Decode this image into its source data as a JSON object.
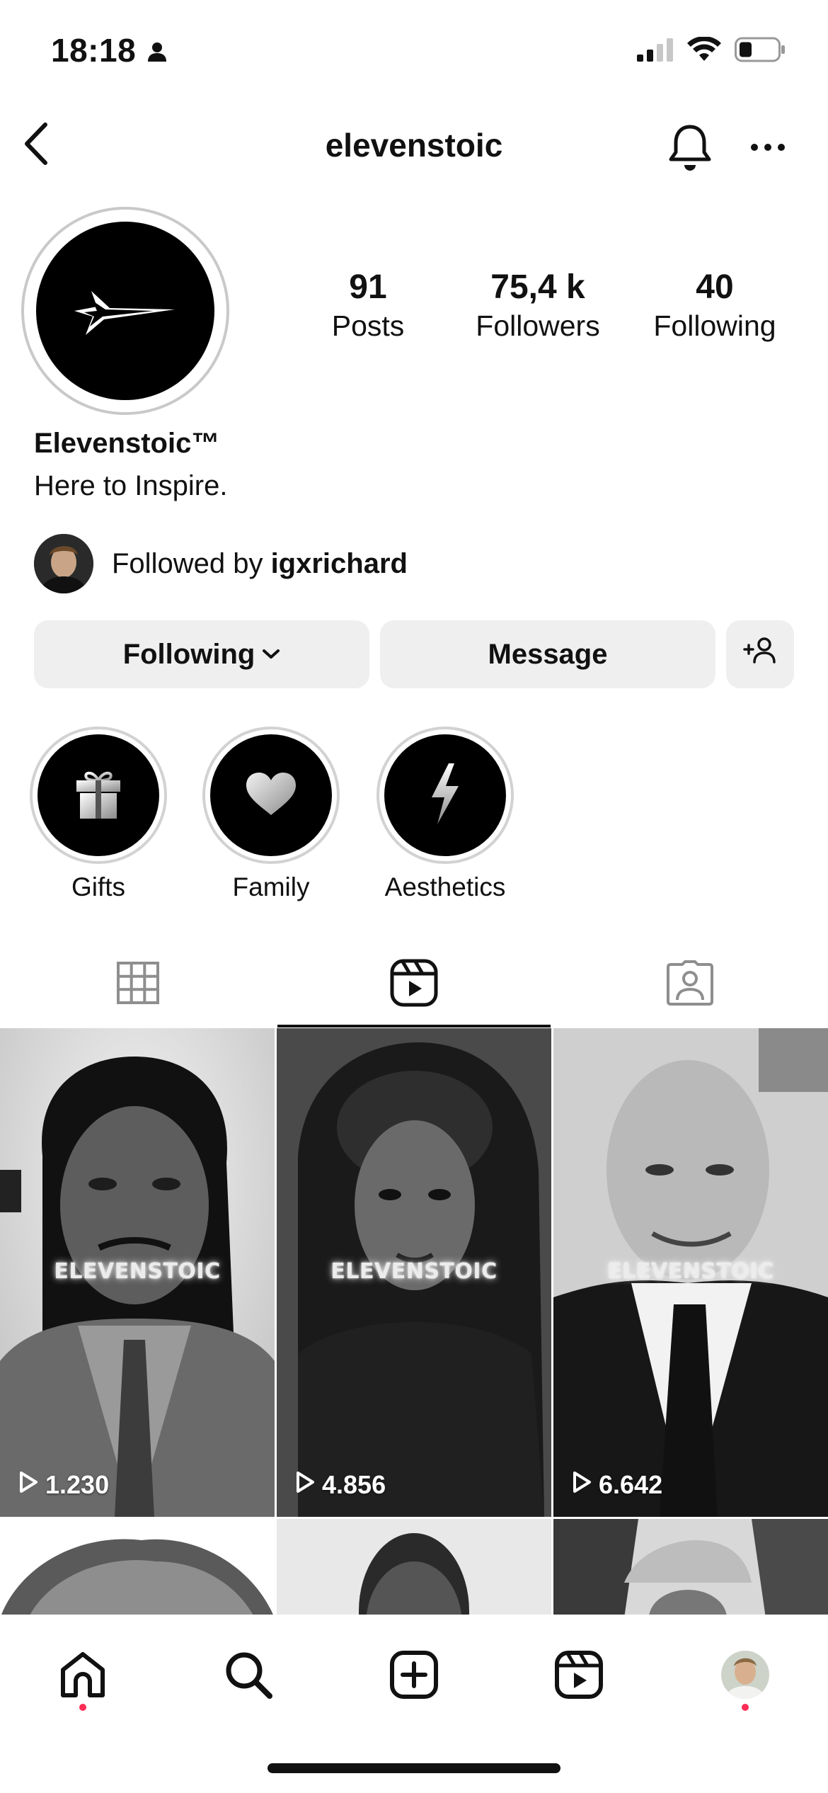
{
  "status_bar": {
    "time": "18:18"
  },
  "header": {
    "username": "elevenstoic"
  },
  "profile": {
    "stats": [
      {
        "count": "91",
        "label": "Posts"
      },
      {
        "count": "75,4 k",
        "label": "Followers"
      },
      {
        "count": "40",
        "label": "Following"
      }
    ],
    "display_name": "Elevenstoic™",
    "bio": "Here to Inspire.",
    "followed_by_prefix": "Followed by ",
    "followed_by_user": "igxrichard"
  },
  "actions": {
    "following_label": "Following",
    "message_label": "Message"
  },
  "highlights": [
    {
      "label": "Gifts",
      "icon": "gift-icon"
    },
    {
      "label": "Family",
      "icon": "heart-icon"
    },
    {
      "label": "Aesthetics",
      "icon": "lightning-icon"
    }
  ],
  "tabs": [
    {
      "name": "posts-grid",
      "icon": "grid-icon",
      "active": false
    },
    {
      "name": "reels",
      "icon": "reels-icon",
      "active": true
    },
    {
      "name": "tagged",
      "icon": "tagged-person-icon",
      "active": false
    }
  ],
  "reels": [
    {
      "caption": "ELEVENSTOIC",
      "views": "1.230"
    },
    {
      "caption": "ELEVENSTOIC",
      "views": "4.856"
    },
    {
      "caption": "ELEVENSTOIC",
      "views": "6.642"
    }
  ],
  "bottom_nav": [
    {
      "name": "home",
      "icon": "home-icon",
      "notification_dot": true
    },
    {
      "name": "search",
      "icon": "search-icon",
      "notification_dot": false
    },
    {
      "name": "create",
      "icon": "plus-square-icon",
      "notification_dot": false
    },
    {
      "name": "reels",
      "icon": "reels-icon",
      "notification_dot": false
    },
    {
      "name": "profile",
      "icon": "profile-avatar",
      "notification_dot": true
    }
  ],
  "colors": {
    "button_bg": "#efefef",
    "notification_dot": "#ff2d55",
    "text": "#111111"
  }
}
